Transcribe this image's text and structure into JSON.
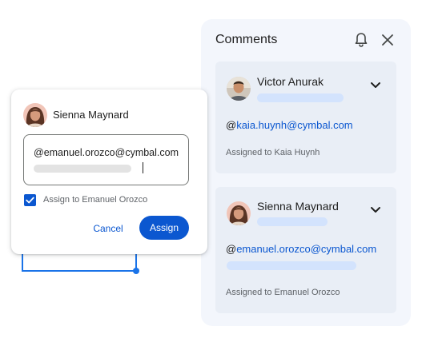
{
  "comments_panel": {
    "title": "Comments",
    "icons": {
      "bell": "bell-icon",
      "close": "close-icon"
    },
    "comments": [
      {
        "author": "Victor Anurak",
        "mention_prefix": "@",
        "mention": "kaia.huynh@cymbal.com",
        "assigned_text": "Assigned to Kaia Huynh"
      },
      {
        "author": "Sienna Maynard",
        "mention_prefix": "@",
        "mention": "emanuel.orozco@cymbal.com",
        "assigned_text": "Assigned to Emanuel Orozco"
      }
    ]
  },
  "assign_dialog": {
    "author": "Sienna Maynard",
    "input_value": "@emanuel.orozco@cymbal.com",
    "checkbox_label": "Assign to Emanuel Orozco",
    "checkbox_checked": true,
    "cancel_label": "Cancel",
    "assign_label": "Assign"
  },
  "colors": {
    "accent": "#0b57d0",
    "panel_bg": "#f3f6fc",
    "card_bg": "#e9eef6",
    "placeholder": "#d3e3fd"
  }
}
